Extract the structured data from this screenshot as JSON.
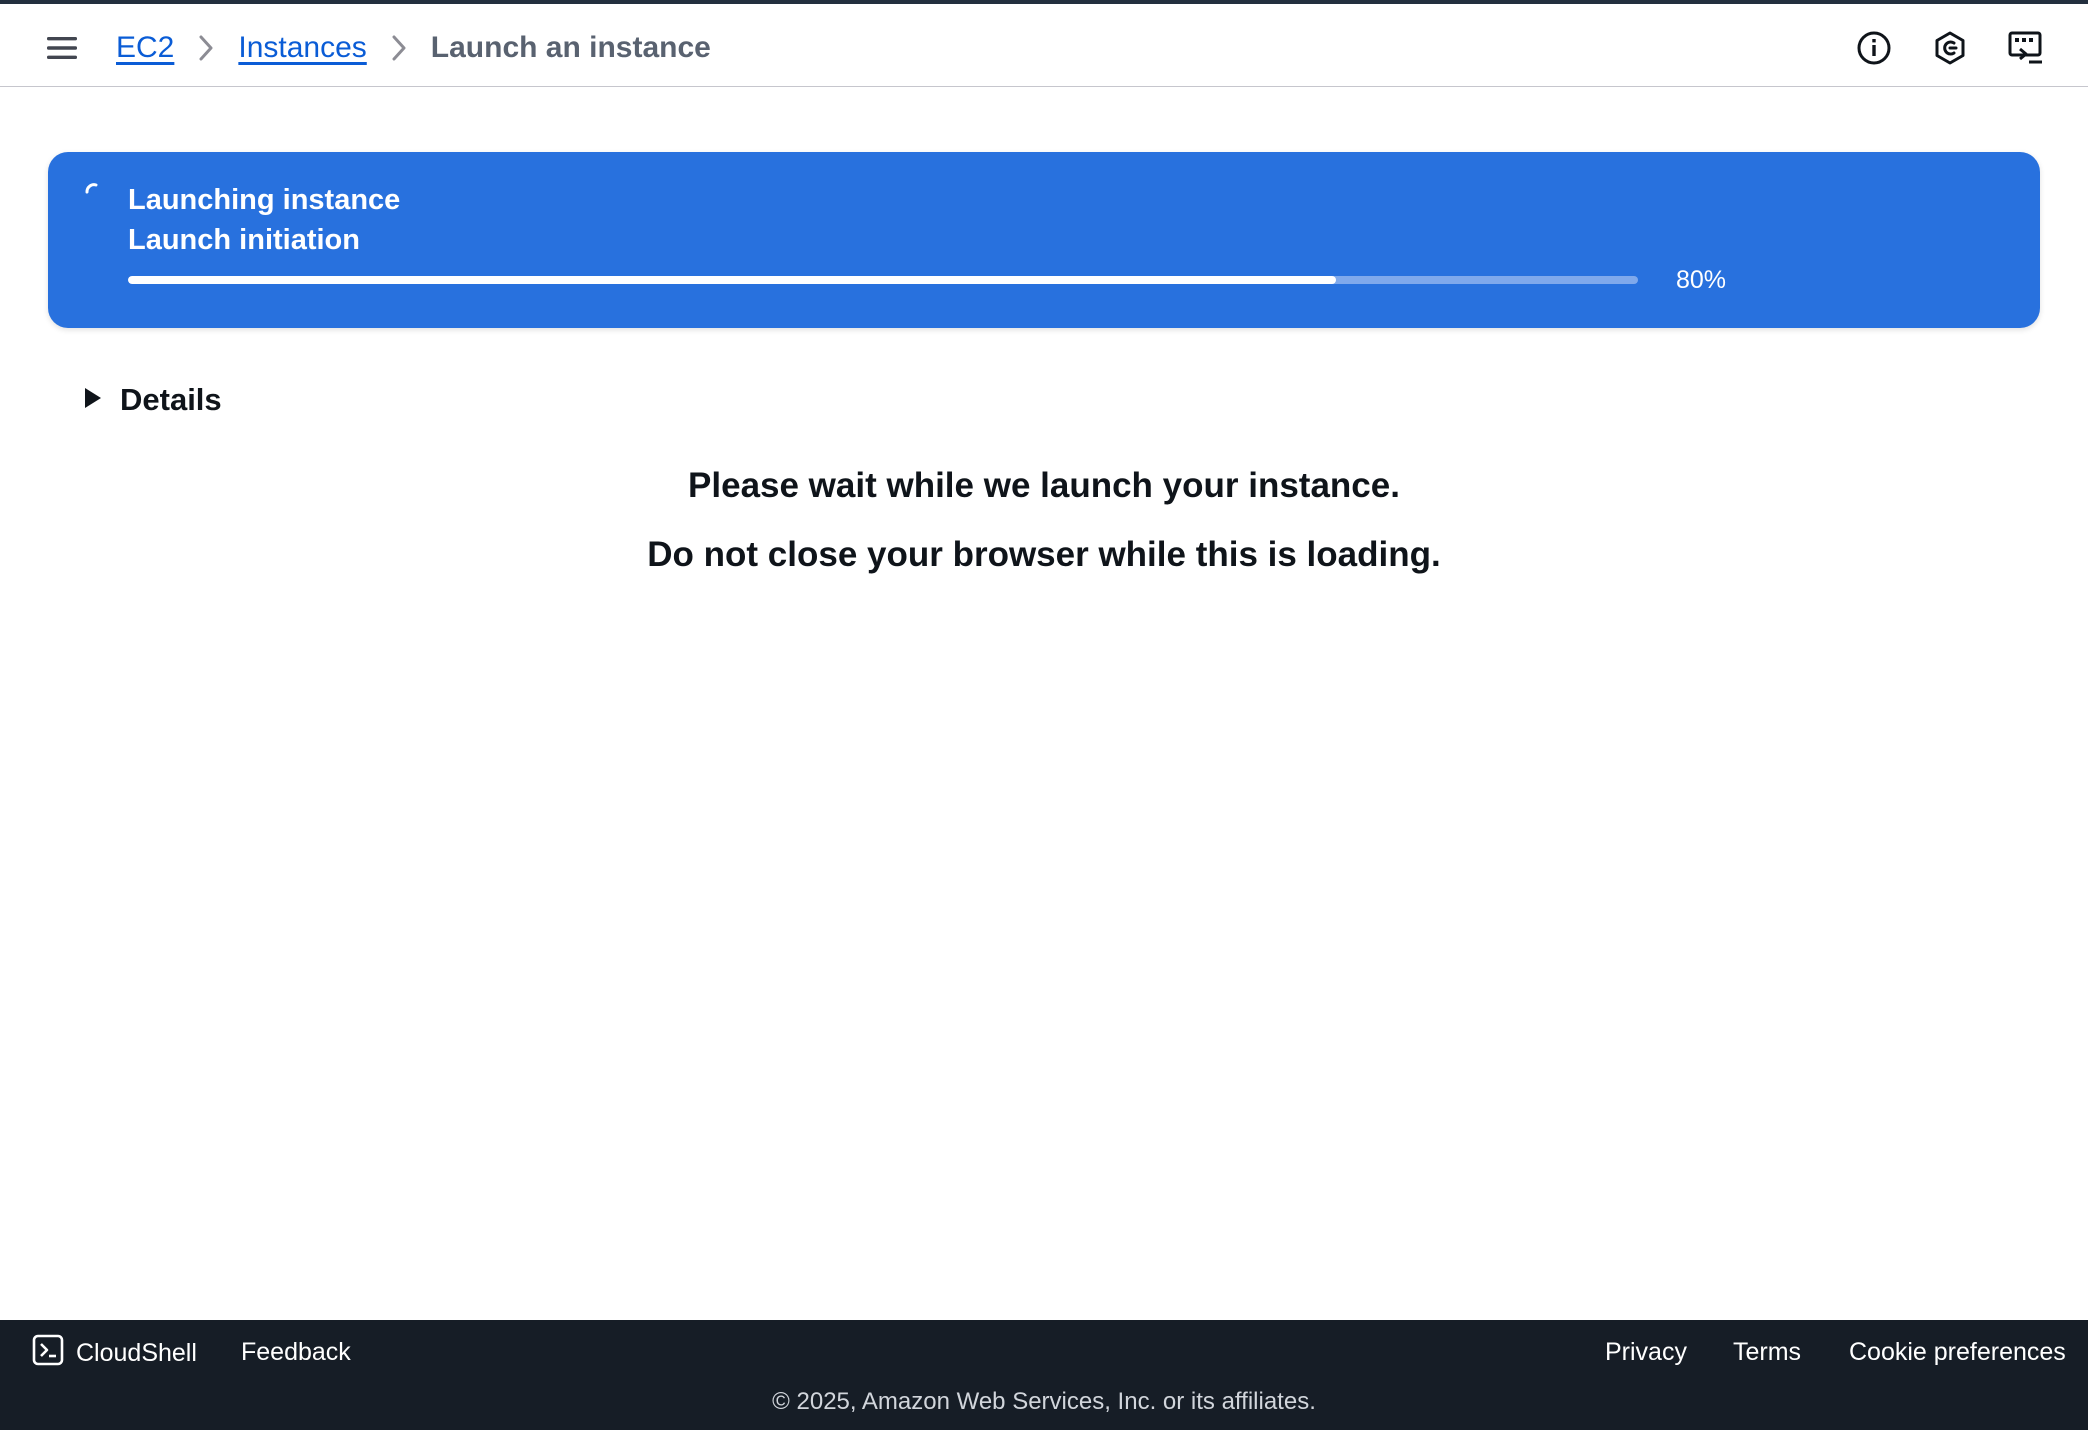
{
  "header": {
    "breadcrumbs": [
      {
        "label": "EC2"
      },
      {
        "label": "Instances"
      },
      {
        "label": "Launch an instance"
      }
    ],
    "icons": [
      "menu-icon",
      "info-icon",
      "settings-icon",
      "cloudshell-terminal-icon"
    ]
  },
  "flash": {
    "title": "Launching instance",
    "subtitle": "Launch initiation",
    "progress_percent": 80,
    "progress_label": "80%",
    "background_color": "#2871de"
  },
  "details": {
    "label": "Details"
  },
  "message": {
    "line1": "Please wait while we launch your instance.",
    "line2": "Do not close your browser while this is loading."
  },
  "footer": {
    "cloudshell": "CloudShell",
    "feedback": "Feedback",
    "privacy": "Privacy",
    "terms": "Terms",
    "cookie": "Cookie preferences",
    "copyright": "© 2025, Amazon Web Services, Inc. or its affiliates."
  },
  "colors": {
    "link": "#0a5cd6",
    "footer_bg": "#161d26"
  }
}
